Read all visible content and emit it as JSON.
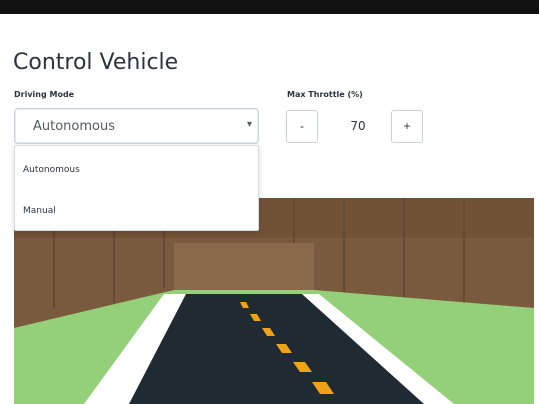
{
  "header": {
    "title": "Control Vehicle"
  },
  "driving_mode": {
    "label": "Driving Mode",
    "selected": "Autonomous",
    "options": [
      "Autonomous",
      "Manual"
    ]
  },
  "max_throttle": {
    "label": "Max Throttle (%)",
    "value": "70",
    "decrement_label": "-",
    "increment_label": "+"
  },
  "colors": {
    "title_text": "#2b3440",
    "wall": "#7a5a3e",
    "floor": "#94d07a",
    "road": "#1f2a33",
    "lane_marking": "#f2a21a"
  },
  "icons": {
    "select_caret": "caret-down-icon"
  }
}
